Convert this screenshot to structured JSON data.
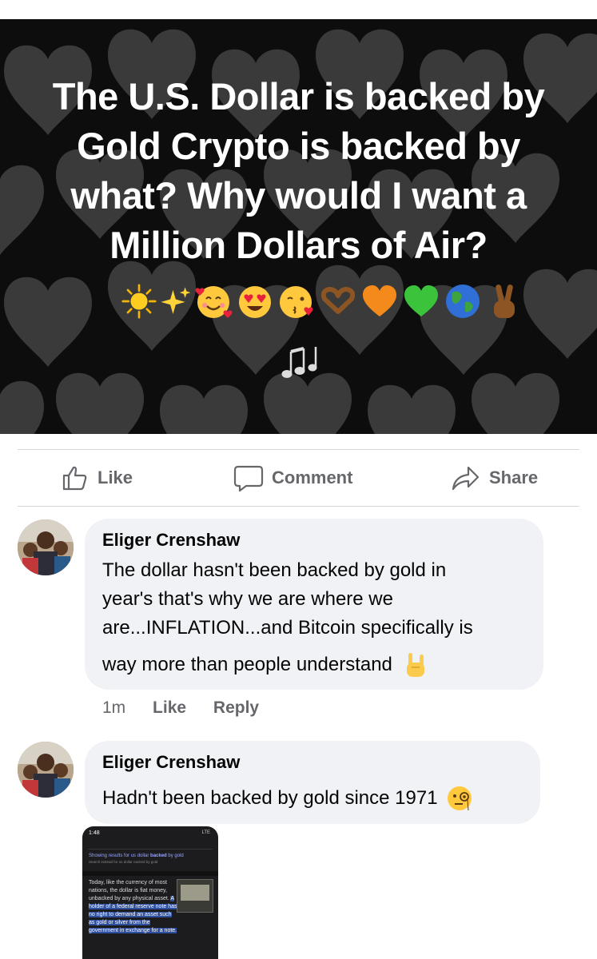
{
  "post": {
    "text": "The U.S. Dollar is backed by Gold Crypto is backed by what? Why would I want a Million Dollars of Air?",
    "emojis": [
      "sun",
      "sparkles",
      "smiling-face-with-hearts",
      "heart-eyes",
      "face-blowing-kiss",
      "heart-hands",
      "orange-heart",
      "green-heart",
      "globe",
      "victory-hand"
    ],
    "notes_emoji": "musical-notes",
    "background_color": "#0d0d0d",
    "heart_pattern_color": "#3a3a3a"
  },
  "actions": {
    "like_label": "Like",
    "comment_label": "Comment",
    "share_label": "Share",
    "icon_color": "#65676b"
  },
  "comments": [
    {
      "author": "Eliger Crenshaw",
      "lines": [
        "The dollar hasn't been backed by gold in",
        "year's that's why we are where we",
        "are...INFLATION...and Bitcoin specifically is",
        "way more than people understand"
      ],
      "trailing_emoji": "sign-of-the-horns",
      "time": "1m",
      "like_label": "Like",
      "reply_label": "Reply"
    },
    {
      "author": "Eliger Crenshaw",
      "lines": [
        "Hadn't been backed by gold since 1971"
      ],
      "trailing_emoji": "face-with-monocle",
      "attachment": {
        "status_time": "1:48",
        "status_right": "LTE",
        "results_prefix": "Showing results for us dollar",
        "results_bold": "backed",
        "results_suffix": "by gold",
        "search_instead": "Search instead for us dollar nacked by gold",
        "para_plain": "Today, like the currency of most nations, the dollar is fiat money, unbacked by any physical asset.",
        "para_highlight": "A holder of a federal reserve note has no right to demand an asset such as gold or silver from the government in exchange for a note."
      }
    }
  ]
}
